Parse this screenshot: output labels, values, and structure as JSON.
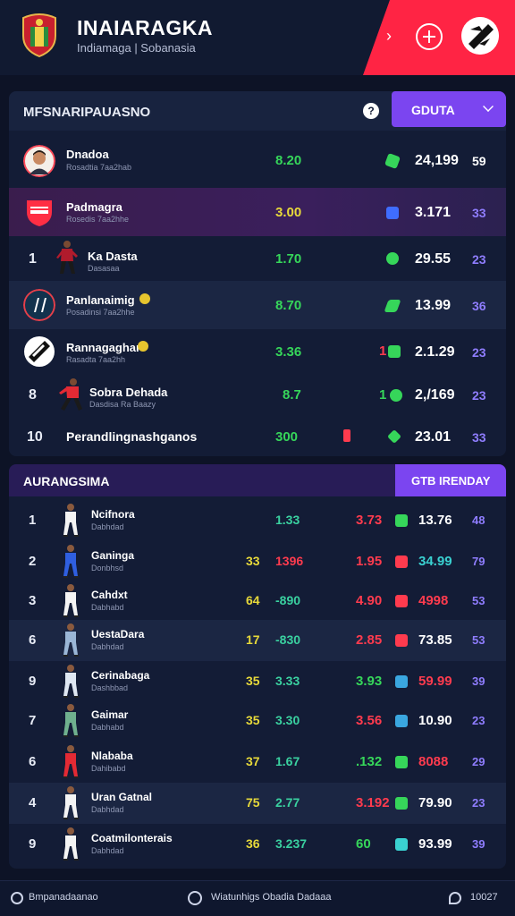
{
  "header": {
    "title": "INAIARAGKA",
    "subtitle": "Indiamaga | Sobanasia"
  },
  "panel1": {
    "title": "MFSNARIPAUASNO",
    "help_label": "?",
    "dropdown_label": "GDUTA",
    "rows": [
      {
        "rank": "",
        "name": "Dnadoa",
        "sub": "Rosadtia 7aa2hab",
        "v1": "8.20",
        "v2": "24,199",
        "v3": "59"
      },
      {
        "rank": "",
        "name": "Padmagra",
        "sub": "Rosedis 7aa2hhe",
        "v1": "3.00",
        "v2": "3.171",
        "v3": "33"
      },
      {
        "rank": "1",
        "name": "Ka Dasta",
        "sub": "Dasasaa",
        "v1": "1.70",
        "v2": "29.55",
        "v3": "23"
      },
      {
        "rank": "",
        "name": "Panlanaimig",
        "sub": "Posadinsi 7aa2hhe",
        "v1": "8.70",
        "v2": "13.99",
        "v3": "36"
      },
      {
        "rank": "",
        "name": "Rannagaghar",
        "sub": "Rasadta 7aa2hh",
        "v1": "3.36",
        "v2": "2.1.29",
        "v3": "23"
      },
      {
        "rank": "8",
        "name": "Sobra Dehada",
        "sub": "Dasdisa Ra Baazy",
        "v1": "8.7",
        "v2": "2,/169",
        "v3": "23"
      },
      {
        "rank": "10",
        "name": "Perandlingnashganos",
        "sub": "",
        "v1": "300",
        "v2": "23.01",
        "v3": "33"
      }
    ],
    "mid_labels": [
      "1",
      "1"
    ]
  },
  "panel2": {
    "title": "AURANGSIMA",
    "button_label": "GTB IRENDAY",
    "rows": [
      {
        "rank": "1",
        "name": "Ncifnora",
        "sub": "Dabhdad",
        "c1": "",
        "c2": "1.33",
        "c3": "3.73",
        "c4": "13.76",
        "c5": "48"
      },
      {
        "rank": "2",
        "name": "Ganinga",
        "sub": "Donbhsd",
        "c1": "33",
        "c2": "1396",
        "c3": "1.95",
        "c4": "34.99",
        "c5": "79"
      },
      {
        "rank": "3",
        "name": "Cahdxt",
        "sub": "Dabhabd",
        "c1": "64",
        "c2": "-890",
        "c3": "4.90",
        "c4": "4998",
        "c5": "53"
      },
      {
        "rank": "6",
        "name": "UestaDara",
        "sub": "Dabhdad",
        "c1": "17",
        "c2": "-830",
        "c3": "2.85",
        "c4": "73.85",
        "c5": "53"
      },
      {
        "rank": "9",
        "name": "Cerinabaga",
        "sub": "Dashbbad",
        "c1": "35",
        "c2": "3.33",
        "c3": "3.93",
        "c4": "59.99",
        "c5": "39"
      },
      {
        "rank": "7",
        "name": "Gaimar",
        "sub": "Dabhabd",
        "c1": "35",
        "c2": "3.30",
        "c3": "3.56",
        "c4": "10.90",
        "c5": "23"
      },
      {
        "rank": "6",
        "name": "Nlababa",
        "sub": "Dahibabd",
        "c1": "37",
        "c2": "1.67",
        "c3": ".132",
        "c4": "8088",
        "c5": "29"
      },
      {
        "rank": "4",
        "name": "Uran Gatnal",
        "sub": "Dabhdad",
        "c1": "75",
        "c2": "2.77",
        "c3": "3.192",
        "c4": "79.90",
        "c5": "23"
      },
      {
        "rank": "9",
        "name": "Coatmilonterais",
        "sub": "Dabhdad",
        "c1": "36",
        "c2": "3.237",
        "c3": "60",
        "c4": "93.99",
        "c5": "39"
      }
    ]
  },
  "footer": {
    "left": "Bmpanadaanao",
    "center": "Wiatunhigs Obadia Dadaaa",
    "right": "10027"
  },
  "colors": {
    "accent_purple": "#7b45f0",
    "accent_red": "#ff2444",
    "green": "#36d65a",
    "yellow": "#e7d93a",
    "red": "#ff3b4e",
    "violet": "#8f7dff"
  }
}
